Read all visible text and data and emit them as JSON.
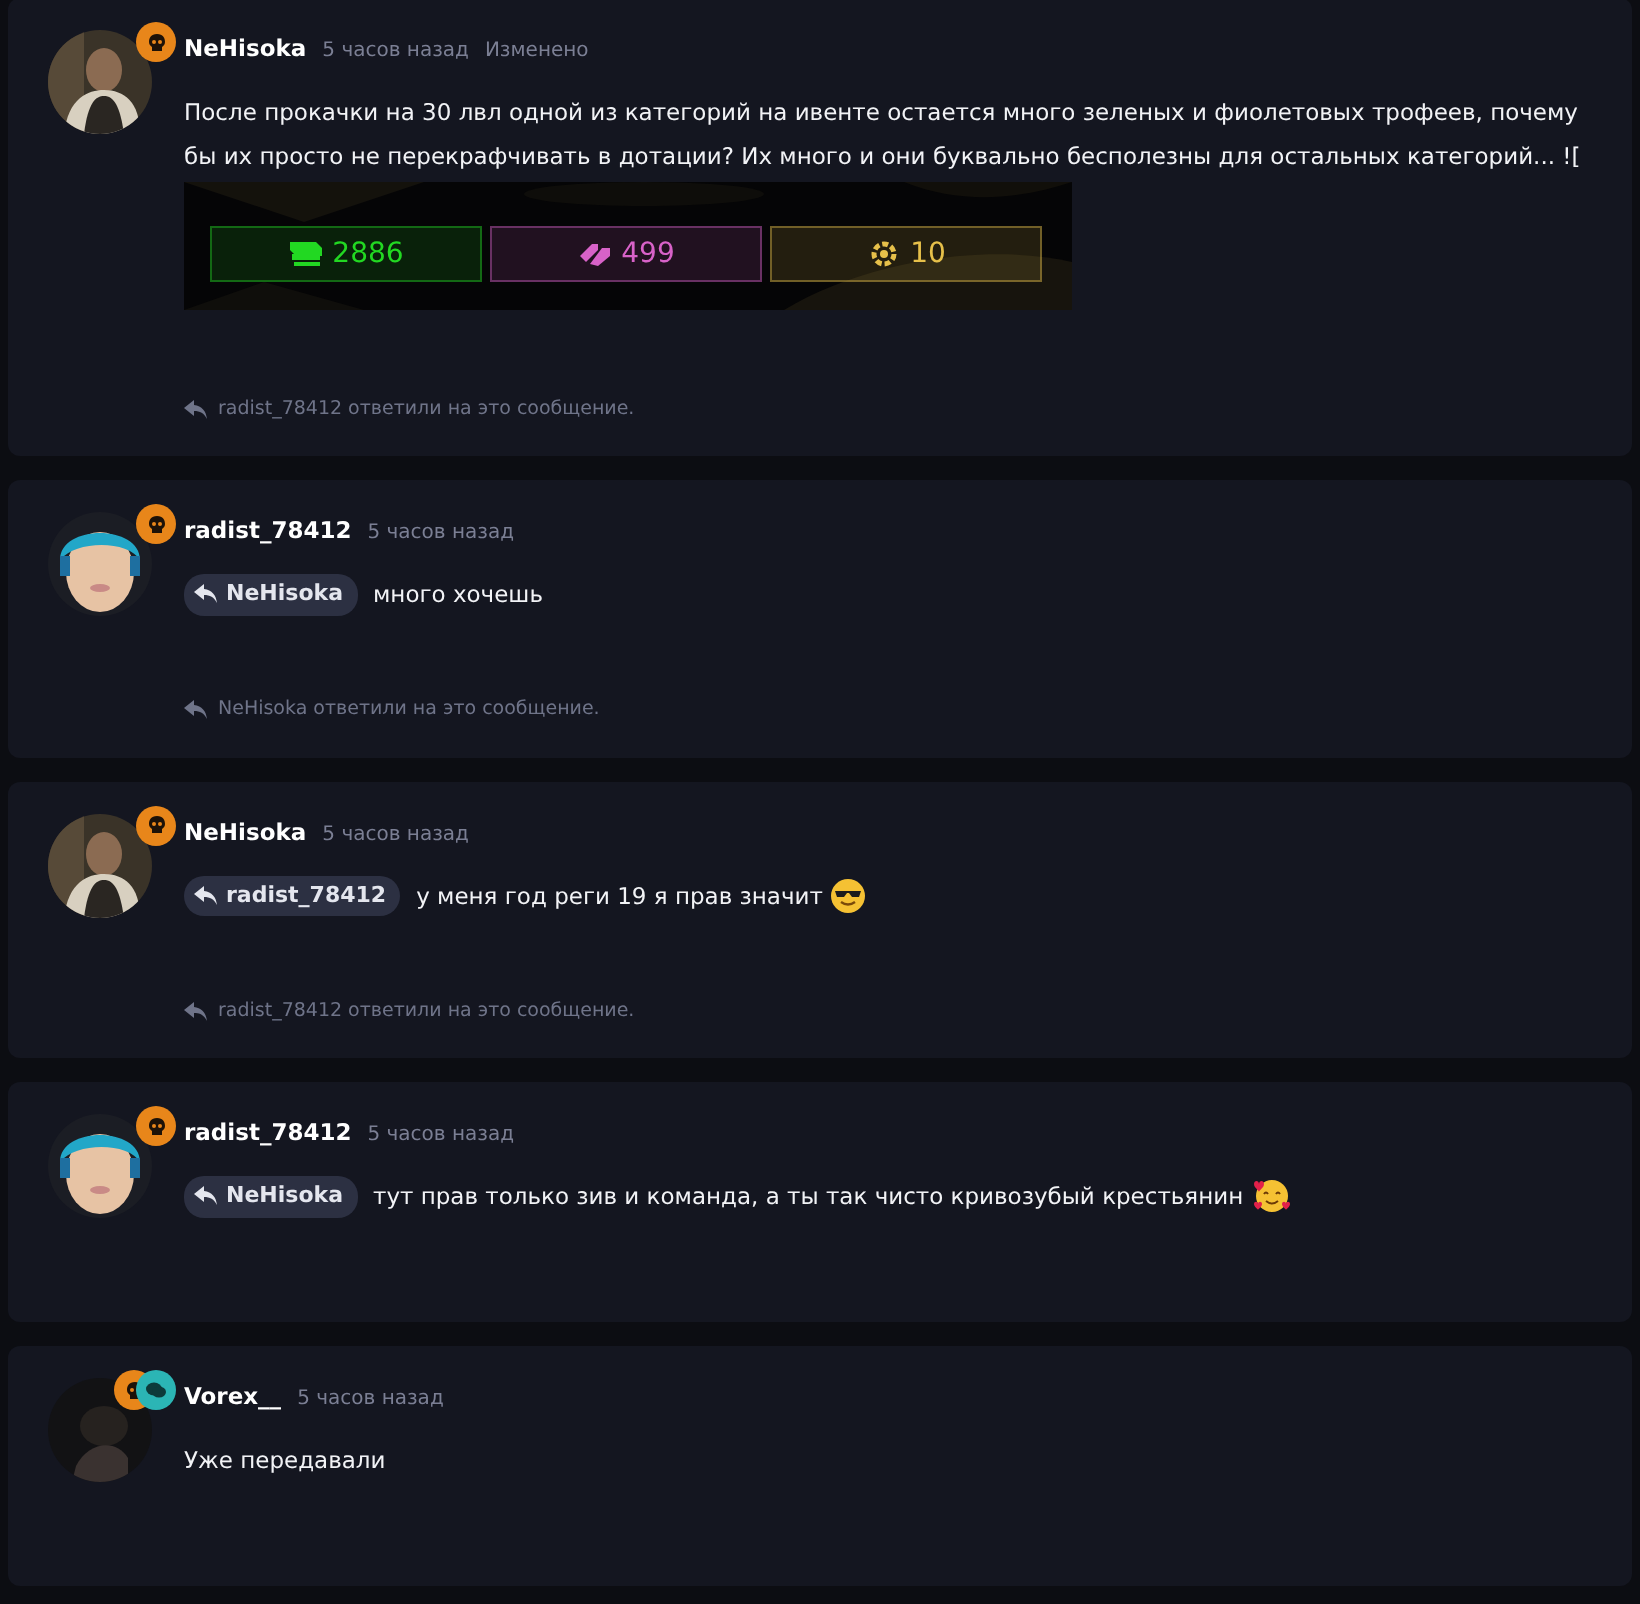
{
  "messages": [
    {
      "author": "NeHisoka",
      "time": "5 часов назад",
      "edited": "Изменено",
      "avatar": {
        "kind": "man"
      },
      "badges": [
        {
          "kind": "skull",
          "color": "#e8861a"
        }
      ],
      "text": "После прокачки на 30 лвл одной из категорий на ивенте остается много зеленых и фиолетовых трофеев, почему бы их просто не перекрафчивать в дотации? Их много и они буквально бесполезны для остальных категорий... ![",
      "attachment": {
        "kind": "picture",
        "tiles": [
          {
            "kind": "cash",
            "value": "2886",
            "color": "#22d822"
          },
          {
            "kind": "tags",
            "value": "499",
            "color": "#d862c8"
          },
          {
            "kind": "gear",
            "value": "10",
            "color": "#e6c04a"
          }
        ]
      },
      "replies_note": "radist_78412 ответили на это сообщение."
    },
    {
      "author": "radist_78412",
      "time": "5 часов назад",
      "avatar": {
        "kind": "blue"
      },
      "badges": [
        {
          "kind": "skull",
          "color": "#e8861a"
        }
      ],
      "reply_to": "NeHisoka",
      "text": "много хочешь",
      "replies_note": "NeHisoka ответили на это сообщение."
    },
    {
      "author": "NeHisoka",
      "time": "5 часов назад",
      "avatar": {
        "kind": "man"
      },
      "badges": [
        {
          "kind": "skull",
          "color": "#e8861a"
        }
      ],
      "reply_to": "radist_78412",
      "text": "у меня год реги 19 я прав значит",
      "emoji": {
        "kind": "sunglasses"
      },
      "replies_note": "radist_78412 ответили на это сообщение."
    },
    {
      "author": "radist_78412",
      "time": "5 часов назад",
      "avatar": {
        "kind": "blue"
      },
      "badges": [
        {
          "kind": "skull",
          "color": "#e8861a"
        }
      ],
      "reply_to": "NeHisoka",
      "text": "тут прав только зив и команда, а ты так чисто кривозубый крестьянин",
      "emoji": {
        "kind": "hearts"
      }
    },
    {
      "author": "Vorex__",
      "time": "5 часов назад",
      "avatar": {
        "kind": "dark"
      },
      "badges": [
        {
          "kind": "skull",
          "color": "#e8861a"
        },
        {
          "kind": "chat",
          "color": "#2bb5b5"
        }
      ],
      "text": "Уже передавали"
    }
  ]
}
